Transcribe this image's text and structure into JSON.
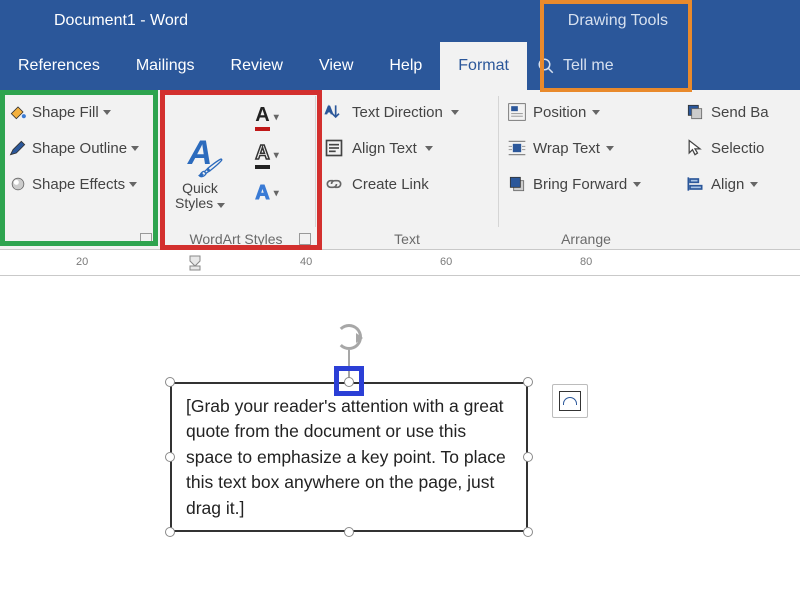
{
  "title": "Document1  -  Word",
  "contextual_tab": "Drawing Tools",
  "tabs": [
    "References",
    "Mailings",
    "Review",
    "View",
    "Help",
    "Format"
  ],
  "tellme": "Tell me",
  "shape": {
    "fill": "Shape Fill",
    "outline": "Shape Outline",
    "effects": "Shape Effects"
  },
  "wordart": {
    "quick": "Quick\nStyles",
    "title": "WordArt Styles"
  },
  "text": {
    "direction": "Text Direction",
    "align": "Align Text",
    "link": "Create Link",
    "title": "Text"
  },
  "arrange": {
    "position": "Position",
    "wrap": "Wrap Text",
    "bring": "Bring Forward",
    "title": "Arrange"
  },
  "end": {
    "sendback": "Send Ba",
    "selection": "Selectio",
    "align": "Align"
  },
  "ruler": {
    "20": "20",
    "40": "40",
    "60": "60",
    "80": "80"
  },
  "textbox": "[Grab your reader's attention with a great quote from the document or use this space to emphasize a key point. To place this text box anywhere on the page, just drag it.]"
}
